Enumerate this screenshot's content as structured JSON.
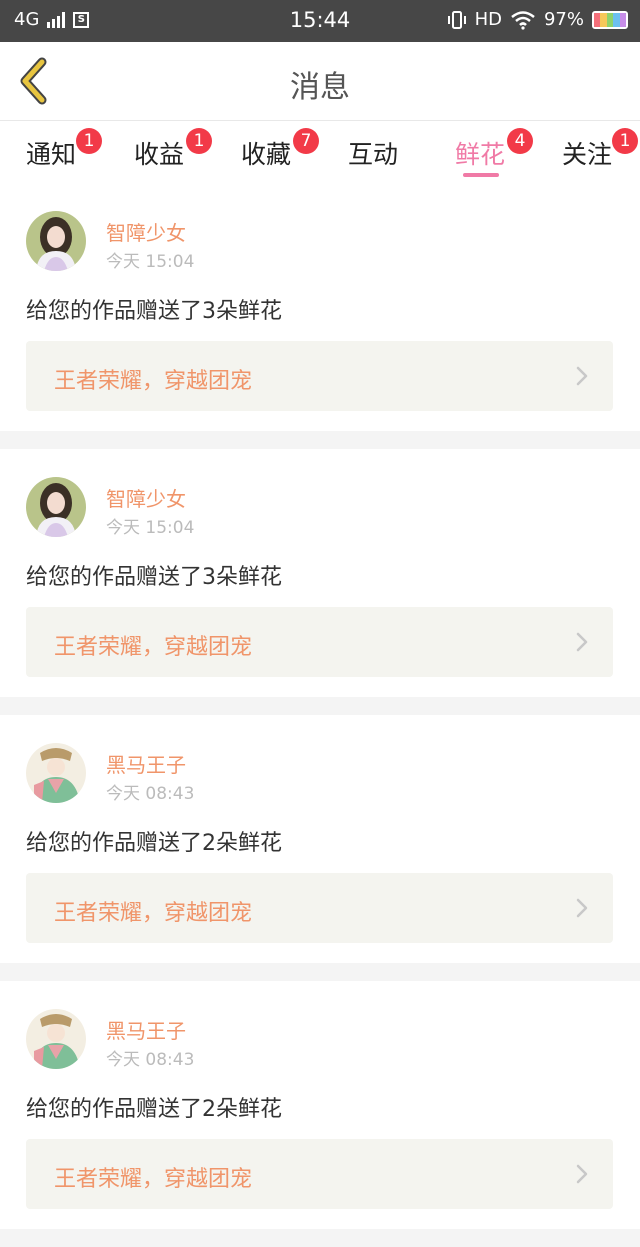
{
  "status_bar": {
    "network": "4G",
    "time": "15:44",
    "hd": "HD",
    "battery": "97%"
  },
  "header": {
    "title": "消息"
  },
  "tabs": [
    {
      "label": "通知",
      "badge": "1"
    },
    {
      "label": "收益",
      "badge": "1"
    },
    {
      "label": "收藏",
      "badge": "7"
    },
    {
      "label": "互动",
      "badge": ""
    },
    {
      "label": "鲜花",
      "badge": "4",
      "active": true
    },
    {
      "label": "关注",
      "badge": "1"
    }
  ],
  "messages": [
    {
      "user": "智障少女",
      "time": "今天 15:04",
      "text": "给您的作品赠送了3朵鲜花",
      "work": "王者荣耀，穿越团宠"
    },
    {
      "user": "智障少女",
      "time": "今天 15:04",
      "text": "给您的作品赠送了3朵鲜花",
      "work": "王者荣耀，穿越团宠"
    },
    {
      "user": "黑马王子",
      "time": "今天 08:43",
      "text": "给您的作品赠送了2朵鲜花",
      "work": "王者荣耀，穿越团宠"
    },
    {
      "user": "黑马王子",
      "time": "今天 08:43",
      "text": "给您的作品赠送了2朵鲜花",
      "work": "王者荣耀，穿越团宠"
    }
  ],
  "colors": {
    "accent": "#f07aa6",
    "badge": "#f23a48",
    "username": "#f0956a",
    "back_arrow": "#e8c540"
  }
}
